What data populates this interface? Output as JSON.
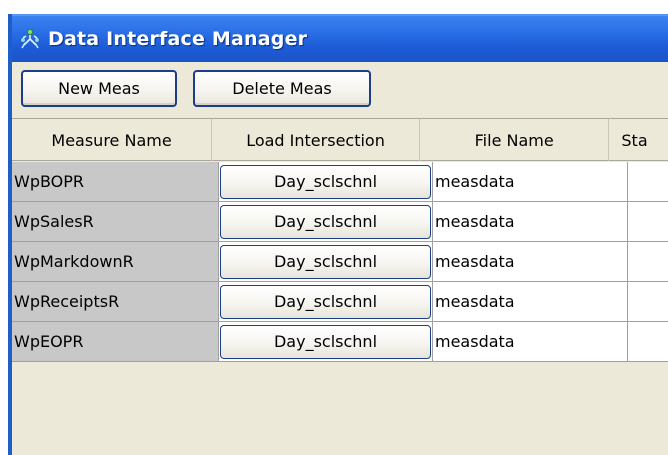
{
  "window": {
    "title": "Data Interface Manager",
    "icon": "people-network-icon"
  },
  "toolbar": {
    "new_label": "New Meas",
    "delete_label": "Delete Meas"
  },
  "table": {
    "columns": [
      "Measure Name",
      "Load Intersection",
      "File Name",
      "Sta"
    ],
    "rows": [
      {
        "measure": "WpBOPR",
        "load": "Day_sclschnl",
        "file": "measdata",
        "status": ""
      },
      {
        "measure": "WpSalesR",
        "load": "Day_sclschnl",
        "file": "measdata",
        "status": ""
      },
      {
        "measure": "WpMarkdownR",
        "load": "Day_sclschnl",
        "file": "measdata",
        "status": ""
      },
      {
        "measure": "WpReceiptsR",
        "load": "Day_sclschnl",
        "file": "measdata",
        "status": ""
      },
      {
        "measure": "WpEOPR",
        "load": "Day_sclschnl",
        "file": "measdata",
        "status": ""
      }
    ]
  },
  "colors": {
    "titlebar": "#2a6fe6",
    "panel": "#ece9d8",
    "name_cell": "#c8c8c8",
    "button_border": "#1c3e8a"
  }
}
